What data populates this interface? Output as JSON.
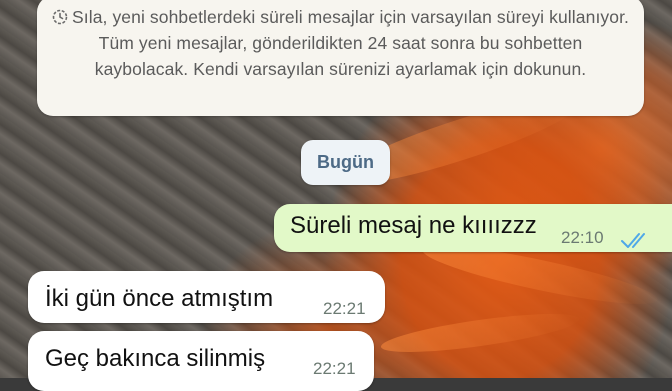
{
  "system_notice": {
    "icon": "timer-icon",
    "text": "Sıla, yeni sohbetlerdeki süreli mesajlar için varsayılan süreyi kullanıyor. Tüm yeni mesajlar, gönderildikten 24 saat sonra bu sohbetten kaybolacak. Kendi varsayılan sürenizi ayarlamak için dokunun."
  },
  "date_chip": {
    "label": "Bugün"
  },
  "messages": [
    {
      "direction": "outgoing",
      "text": "Süreli mesaj ne kıııızzz",
      "time": "22:10",
      "status_icon": "double-check-read-icon",
      "status_color": "#4fa8e8"
    },
    {
      "direction": "incoming",
      "text": "İki gün önce atmıştım",
      "time": "22:21"
    },
    {
      "direction": "incoming",
      "text": "Geç bakınca silinmiş",
      "time": "22:21"
    }
  ],
  "colors": {
    "outgoing_bubble": "#e2f9c8",
    "incoming_bubble": "#ffffff",
    "notice_bg": "#f7f5ef",
    "date_chip_text": "#4d6a86"
  }
}
